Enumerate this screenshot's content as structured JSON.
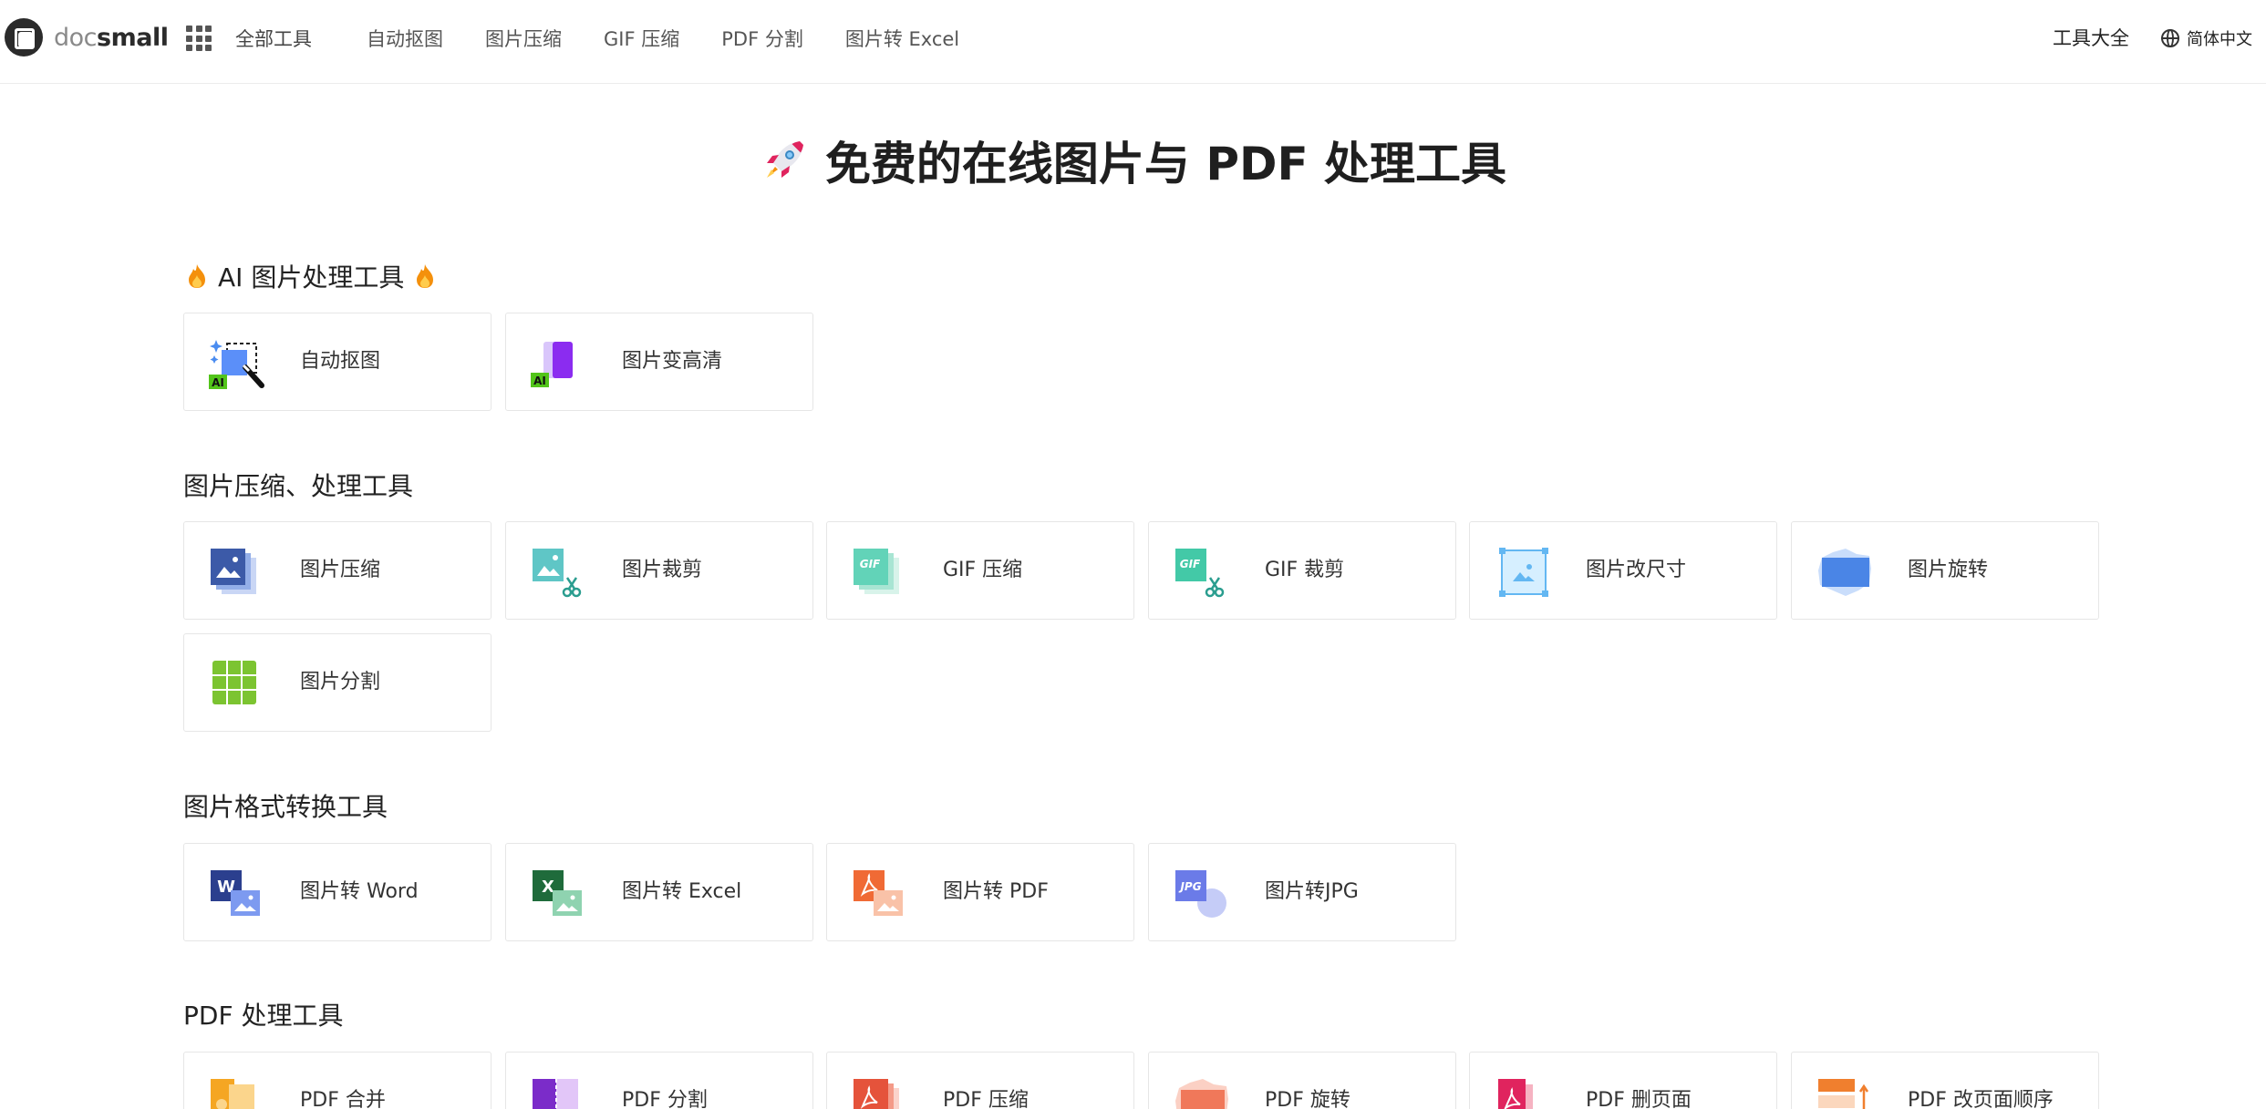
{
  "brand": {
    "doc": "doc",
    "small": "small"
  },
  "nav": {
    "all_tools": "全部工具",
    "links": [
      "自动抠图",
      "图片压缩",
      "GIF 压缩",
      "PDF 分割",
      "图片转 Excel"
    ],
    "tools_catalog": "工具大全",
    "language": "简体中文"
  },
  "hero": {
    "title": "免费的在线图片与 PDF 处理工具"
  },
  "sections": [
    {
      "title": "AI 图片处理工具",
      "tools": [
        "自动抠图",
        "图片变高清"
      ]
    },
    {
      "title": "图片压缩、处理工具",
      "tools": [
        "图片压缩",
        "图片裁剪",
        "GIF 压缩",
        "GIF 裁剪",
        "图片改尺寸",
        "图片旋转",
        "图片分割"
      ]
    },
    {
      "title": "图片格式转换工具",
      "tools": [
        "图片转 Word",
        "图片转 Excel",
        "图片转 PDF",
        "图片转JPG"
      ]
    },
    {
      "title": "PDF 处理工具",
      "tools": [
        "PDF 合并",
        "PDF 分割",
        "PDF 压缩",
        "PDF 旋转",
        "PDF 删页面",
        "PDF 改页面顺序"
      ]
    }
  ],
  "icon_text": {
    "ai": "AI",
    "gif": "GIF",
    "word": "W",
    "excel": "X",
    "jpg": "JPG"
  },
  "colors": {
    "brand_dark": "#2b2b2b",
    "ai_green": "#52c41a",
    "word_blue": "#2b579a",
    "excel_green": "#217346",
    "pdf_red": "#e5533b"
  }
}
